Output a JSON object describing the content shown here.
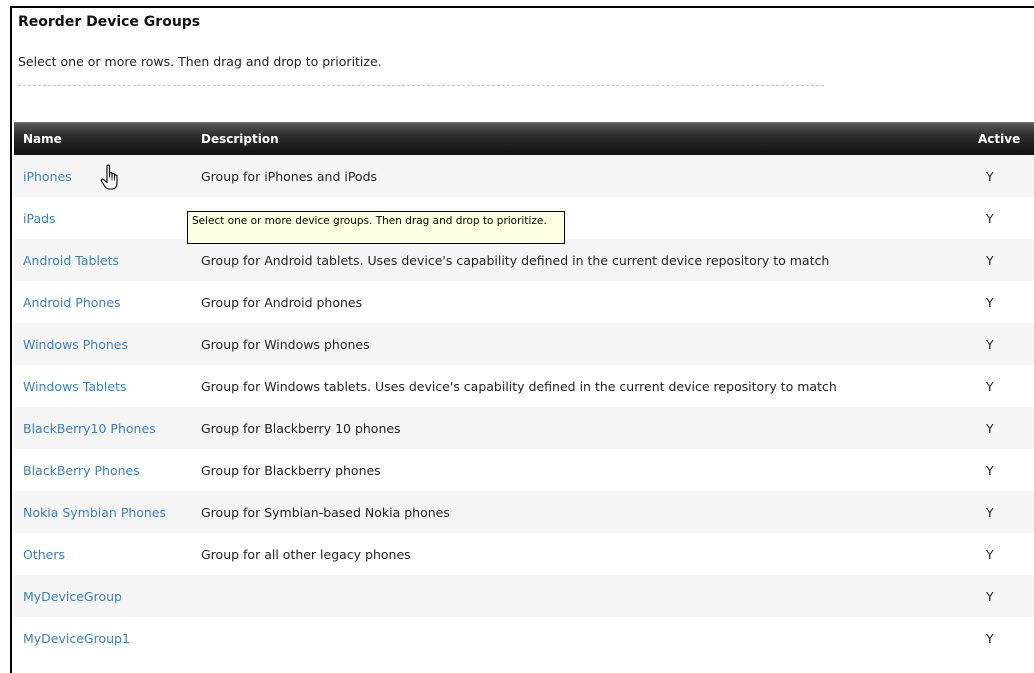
{
  "page": {
    "title": "Reorder Device Groups",
    "instructions": "Select one or more rows. Then drag and drop to prioritize."
  },
  "grid": {
    "columns": {
      "name": "Name",
      "description": "Description",
      "active": "Active"
    },
    "rows": [
      {
        "name": "iPhones",
        "description": "Group for iPhones and iPods",
        "active": "Y"
      },
      {
        "name": "iPads",
        "description": "",
        "active": "Y"
      },
      {
        "name": "Android Tablets",
        "description": "Group for Android tablets. Uses device's capability defined in the current device repository to match",
        "active": "Y"
      },
      {
        "name": "Android Phones",
        "description": "Group for Android phones",
        "active": "Y"
      },
      {
        "name": "Windows Phones",
        "description": "Group for Windows phones",
        "active": "Y"
      },
      {
        "name": "Windows Tablets",
        "description": "Group for Windows tablets. Uses device's capability defined in the current device repository to match",
        "active": "Y"
      },
      {
        "name": "BlackBerry10 Phones",
        "description": "Group for Blackberry 10 phones",
        "active": "Y"
      },
      {
        "name": "BlackBerry Phones",
        "description": "Group for Blackberry phones",
        "active": "Y"
      },
      {
        "name": "Nokia Symbian Phones",
        "description": "Group for Symbian-based Nokia phones",
        "active": "Y"
      },
      {
        "name": "Others",
        "description": "Group for all other legacy phones",
        "active": "Y"
      },
      {
        "name": "MyDeviceGroup",
        "description": "",
        "active": "Y"
      },
      {
        "name": "MyDeviceGroup1",
        "description": "",
        "active": "Y"
      }
    ]
  },
  "tooltip": {
    "text": "Select one or more device groups. Then drag and drop to prioritize."
  },
  "icons": {
    "cursor": "hand-pointer-cursor-icon"
  },
  "colors": {
    "link": "#3a82c4",
    "header_bg": "#1a1a1a",
    "tooltip_bg": "#ffffe1"
  }
}
